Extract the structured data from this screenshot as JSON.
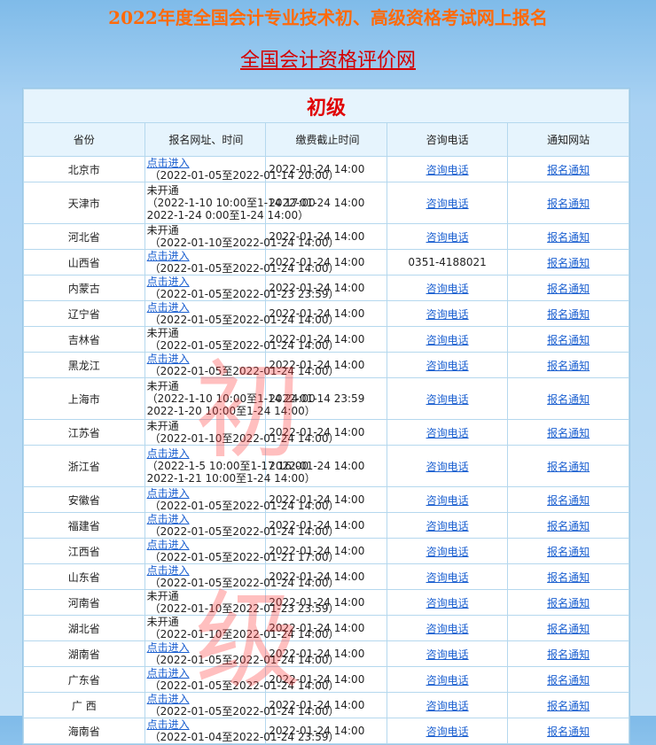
{
  "header": {
    "title": "2022年度全国会计专业技术初、高级资格考试网上报名",
    "site_link": "全国会计资格评价网"
  },
  "table": {
    "level": "初级",
    "columns": [
      "省份",
      "报名网址、时间",
      "缴费截止时间",
      "咨询电话",
      "通知网站"
    ],
    "watermark": [
      "初",
      "级"
    ],
    "rows": [
      {
        "province": "北京市",
        "status": "点击进入",
        "status_link": true,
        "lines": [
          "（2022-01-05至2022-01-14 20:00）"
        ],
        "deadline": "2022-01-24 14:00",
        "phone": "咨询电话",
        "phone_link": true,
        "notice": "报名通知"
      },
      {
        "province": "天津市",
        "status": "未开通",
        "status_link": false,
        "lines": [
          "（2022-1-10 10:00至1-14 17:00",
          "2022-1-24 0:00至1-24 14:00）"
        ],
        "deadline": "2022-01-24 14:00",
        "phone": "咨询电话",
        "phone_link": true,
        "notice": "报名通知"
      },
      {
        "province": "河北省",
        "status": "未开通",
        "status_link": false,
        "lines": [
          "（2022-01-10至2022-01-24 14:00）"
        ],
        "deadline": "2022-01-24 14:00",
        "phone": "咨询电话",
        "phone_link": true,
        "notice": "报名通知"
      },
      {
        "province": "山西省",
        "status": "点击进入",
        "status_link": true,
        "lines": [
          "（2022-01-05至2022-01-24 14:00）"
        ],
        "deadline": "2022-01-24 14:00",
        "phone": "0351-4188021",
        "phone_link": false,
        "notice": "报名通知"
      },
      {
        "province": "内蒙古",
        "status": "点击进入",
        "status_link": true,
        "lines": [
          "（2022-01-05至2022-01-23 23:59）"
        ],
        "deadline": "2022-01-24 14:00",
        "phone": "咨询电话",
        "phone_link": true,
        "notice": "报名通知"
      },
      {
        "province": "辽宁省",
        "status": "点击进入",
        "status_link": true,
        "lines": [
          "（2022-01-05至2022-01-24 14:00）"
        ],
        "deadline": "2022-01-24 14:00",
        "phone": "咨询电话",
        "phone_link": true,
        "notice": "报名通知"
      },
      {
        "province": "吉林省",
        "status": "未开通",
        "status_link": false,
        "lines": [
          "（2022-01-05至2022-01-24 14:00）"
        ],
        "deadline": "2022-01-24 14:00",
        "phone": "咨询电话",
        "phone_link": true,
        "notice": "报名通知"
      },
      {
        "province": "黑龙江",
        "status": "点击进入",
        "status_link": true,
        "lines": [
          "（2022-01-05至2022-01-24 14:00）"
        ],
        "deadline": "2022-01-24 14:00",
        "phone": "咨询电话",
        "phone_link": true,
        "notice": "报名通知"
      },
      {
        "province": "上海市",
        "status": "未开通",
        "status_link": false,
        "lines": [
          "（2022-1-10 10:00至1-14 24:00",
          "2022-1-20 10:00至1-24 14:00）"
        ],
        "deadline": "2022-01-14 23:59",
        "phone": "咨询电话",
        "phone_link": true,
        "notice": "报名通知"
      },
      {
        "province": "江苏省",
        "status": "未开通",
        "status_link": false,
        "lines": [
          "（2022-01-10至2022-01-24 14:00）"
        ],
        "deadline": "2022-01-24 14:00",
        "phone": "咨询电话",
        "phone_link": true,
        "notice": "报名通知"
      },
      {
        "province": "浙江省",
        "status": "点击进入",
        "status_link": true,
        "lines": [
          "（2022-1-5 10:00至1-17 16:00",
          "2022-1-21 10:00至1-24 14:00）"
        ],
        "deadline": "2022-01-24 14:00",
        "phone": "咨询电话",
        "phone_link": true,
        "notice": "报名通知"
      },
      {
        "province": "安徽省",
        "status": "点击进入",
        "status_link": true,
        "lines": [
          "（2022-01-05至2022-01-24 14:00）"
        ],
        "deadline": "2022-01-24 14:00",
        "phone": "咨询电话",
        "phone_link": true,
        "notice": "报名通知"
      },
      {
        "province": "福建省",
        "status": "点击进入",
        "status_link": true,
        "lines": [
          "（2022-01-05至2022-01-24 14:00）"
        ],
        "deadline": "2022-01-24 14:00",
        "phone": "咨询电话",
        "phone_link": true,
        "notice": "报名通知"
      },
      {
        "province": "江西省",
        "status": "点击进入",
        "status_link": true,
        "lines": [
          "（2022-01-05至2022-01-21 17:00）"
        ],
        "deadline": "2022-01-24 14:00",
        "phone": "咨询电话",
        "phone_link": true,
        "notice": "报名通知"
      },
      {
        "province": "山东省",
        "status": "点击进入",
        "status_link": true,
        "lines": [
          "（2022-01-05至2022-01-24 14:00）"
        ],
        "deadline": "2022-01-24 14:00",
        "phone": "咨询电话",
        "phone_link": true,
        "notice": "报名通知"
      },
      {
        "province": "河南省",
        "status": "未开通",
        "status_link": false,
        "lines": [
          "（2022-01-10至2022-01-23 23:59）"
        ],
        "deadline": "2022-01-24 14:00",
        "phone": "咨询电话",
        "phone_link": true,
        "notice": "报名通知"
      },
      {
        "province": "湖北省",
        "status": "未开通",
        "status_link": false,
        "lines": [
          "（2022-01-10至2022-01-24 14:00）"
        ],
        "deadline": "2022-01-24 14:00",
        "phone": "咨询电话",
        "phone_link": true,
        "notice": "报名通知"
      },
      {
        "province": "湖南省",
        "status": "点击进入",
        "status_link": true,
        "lines": [
          "（2022-01-05至2022-01-24 14:00）"
        ],
        "deadline": "2022-01-24 14:00",
        "phone": "咨询电话",
        "phone_link": true,
        "notice": "报名通知"
      },
      {
        "province": "广东省",
        "status": "点击进入",
        "status_link": true,
        "lines": [
          "（2022-01-05至2022-01-24 14:00）"
        ],
        "deadline": "2022-01-24 14:00",
        "phone": "咨询电话",
        "phone_link": true,
        "notice": "报名通知"
      },
      {
        "province": "广 西",
        "status": "点击进入",
        "status_link": true,
        "lines": [
          "（2022-01-05至2022-01-24 14:00）"
        ],
        "deadline": "2022-01-24 14:00",
        "phone": "咨询电话",
        "phone_link": true,
        "notice": "报名通知"
      },
      {
        "province": "海南省",
        "status": "点击进入",
        "status_link": true,
        "lines": [
          "（2022-01-04至2022-01-24 23:59）"
        ],
        "deadline": "2022-01-24 14:00",
        "phone": "咨询电话",
        "phone_link": true,
        "notice": "报名通知"
      }
    ]
  }
}
